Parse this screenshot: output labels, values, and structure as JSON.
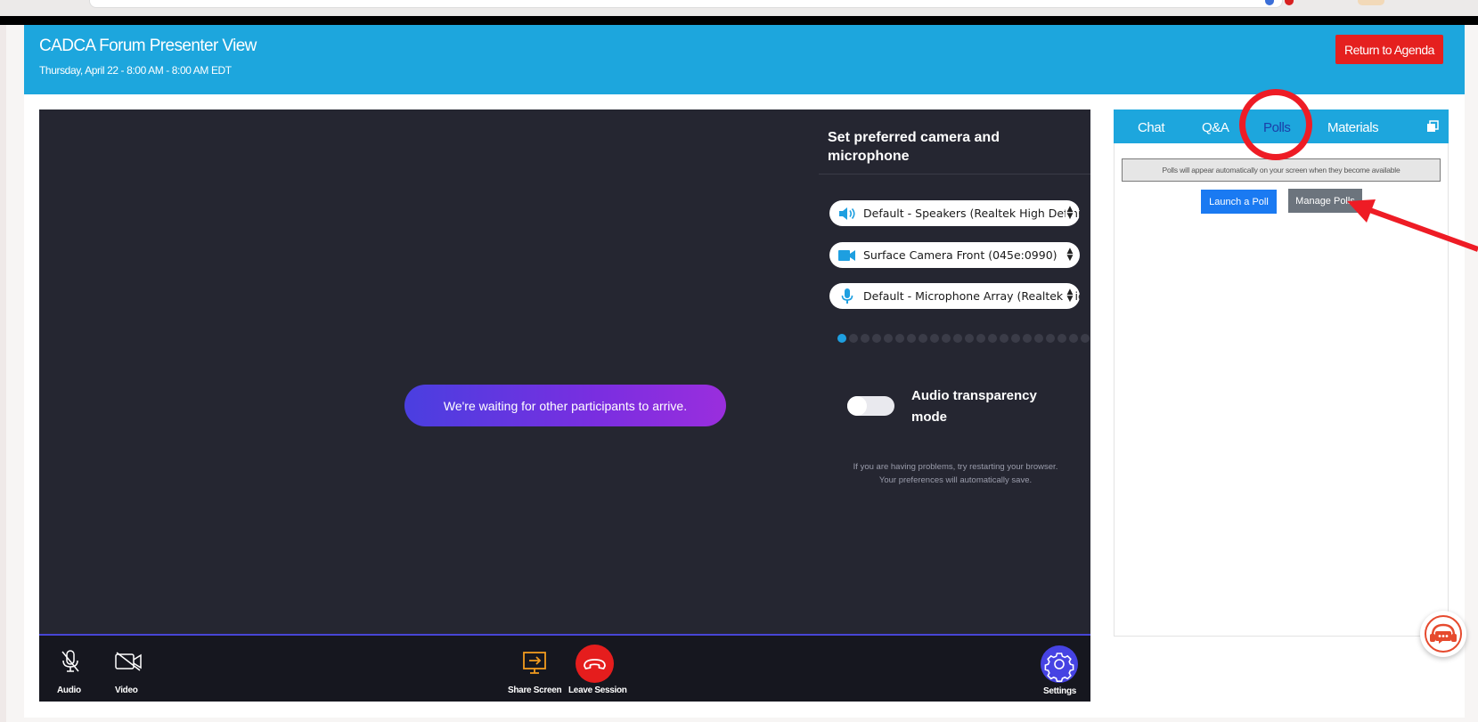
{
  "header": {
    "title": "CADCA Forum Presenter View",
    "subtitle": "Thursday, April 22 - 8:00 AM - 8:00 AM EDT",
    "return_label": "Return to Agenda"
  },
  "stage": {
    "waiting_message": "We're waiting for other participants to arrive."
  },
  "devices": {
    "title": "Set preferred camera and microphone",
    "speaker": "Default - Speakers (Realtek High Definition Audio)",
    "camera": "Surface Camera Front (045e:0990)",
    "microphone": "Default - Microphone Array (Realtek High Definition Audio)",
    "level_dots_total": 22,
    "level_dots_active": 1,
    "transparency_label": "Audio transparency mode",
    "transparency_on": false,
    "help_line1": "If you are having problems, try restarting your browser.",
    "help_line2": "Your preferences will automatically save."
  },
  "controls": {
    "audio_label": "Audio",
    "video_label": "Video",
    "share_label": "Share Screen",
    "leave_label": "Leave Session",
    "settings_label": "Settings"
  },
  "side_panel": {
    "tabs": [
      "Chat",
      "Q&A",
      "Polls",
      "Materials"
    ],
    "active_tab": "Polls",
    "notice": "Polls will appear automatically on your screen when they become available",
    "launch_label": "Launch a Poll",
    "manage_label": "Manage Polls"
  },
  "colors": {
    "header_blue": "#1da6dd",
    "stage_dark": "#252631",
    "leave_red": "#e51d1d",
    "settings_purple": "#4643e3",
    "launch_blue": "#1a7af2",
    "manage_gray": "#6c747d",
    "annotation_red": "#ee1c25"
  }
}
